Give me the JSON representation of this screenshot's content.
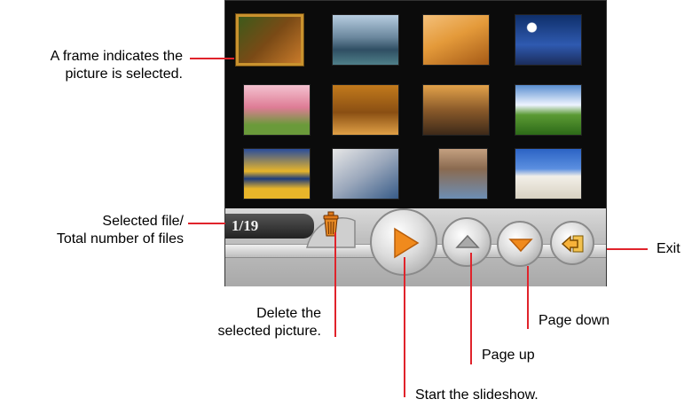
{
  "viewer": {
    "counter": "1/19",
    "thumbnail_subjects": [
      "forest-path",
      "canal-city",
      "desert-dune",
      "moon-mountains",
      "blossom-trees",
      "autumn-alley",
      "winding-road",
      "alpine-meadow",
      "lake-reflection",
      "cliff-village",
      "church-tower",
      "whitewashed-chapel"
    ],
    "selected_index": 0,
    "buttons": [
      "delete",
      "play",
      "page-up",
      "page-down",
      "exit"
    ]
  },
  "annotations": {
    "frame": "A frame indicates the",
    "frame2": "picture is selected.",
    "counter": "Selected file/",
    "counter2": "Total number of files",
    "delete": "Delete the",
    "delete2": "selected picture.",
    "slideshow": "Start the slideshow.",
    "page_up": "Page up",
    "page_down": "Page down",
    "exit": "Exit"
  },
  "colors": {
    "accent_line": "#e0232b",
    "play": "#f08a1d",
    "selection_frame": "#c9922e"
  }
}
